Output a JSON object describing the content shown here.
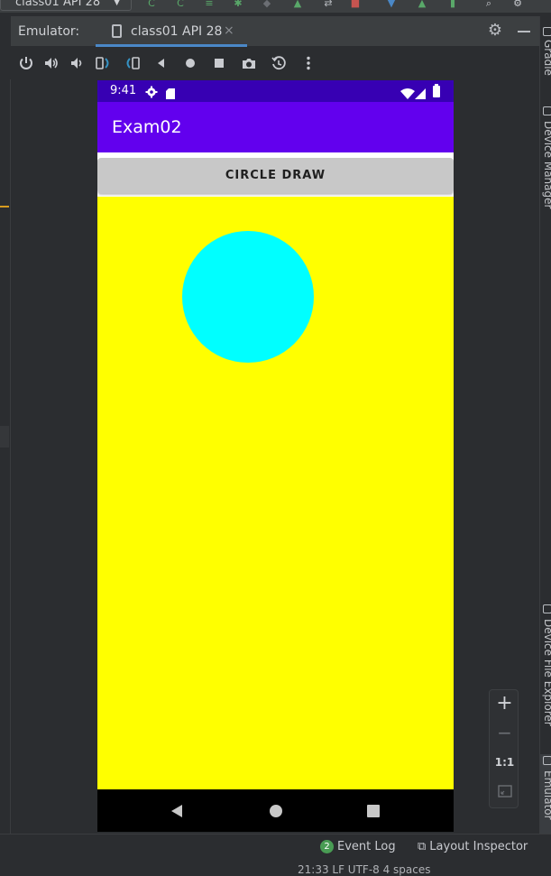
{
  "ide": {
    "device_selector": "class01 API 28",
    "emulator_label": "Emulator:",
    "emulator_tab": "class01 API 28",
    "tab_close": "×",
    "side_tabs": [
      "Gradle",
      "Device Manager",
      "Device File Explorer",
      "Emulator"
    ],
    "zoom": {
      "plus": "+",
      "minus": "−",
      "one_to_one": "1:1"
    },
    "statusbar": {
      "event_log_count": "2",
      "event_log": "Event Log",
      "layout_inspector": "Layout Inspector",
      "bottom_info": "21:33    LF    UTF-8    4 spaces"
    }
  },
  "phone": {
    "status_time": "9:41",
    "app_title": "Exam02",
    "button_label": "CIRCLE DRAW",
    "colors": {
      "status_bar": "#3700b3",
      "app_bar": "#6200ee",
      "canvas": "#ffff00",
      "circle": "#00ffff",
      "nav_bar": "#000000"
    }
  }
}
